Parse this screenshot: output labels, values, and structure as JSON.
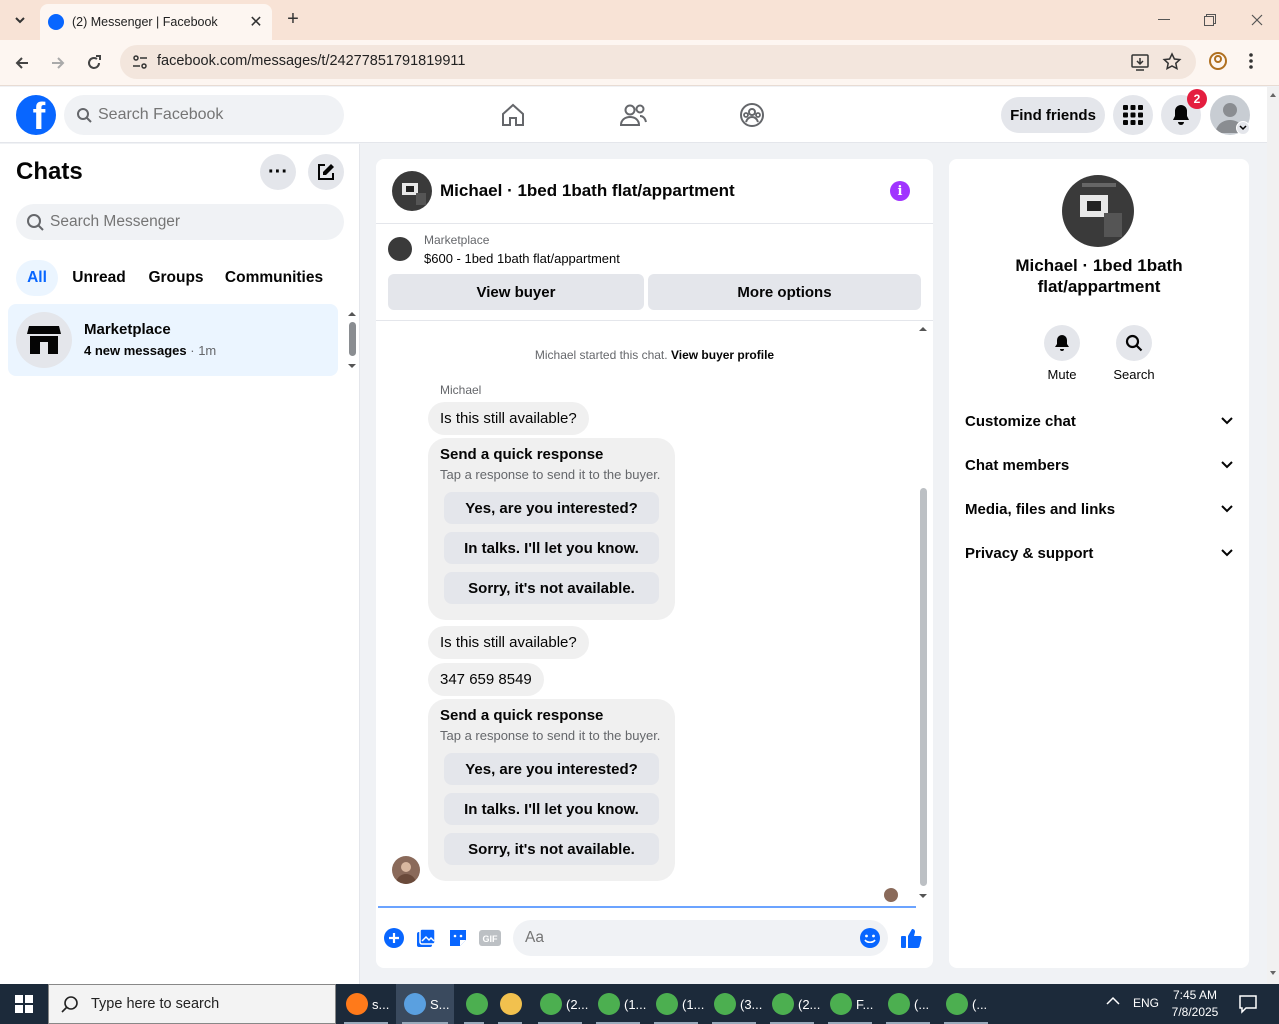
{
  "browser": {
    "tab_title": "(2) Messenger | Facebook",
    "url": "facebook.com/messages/t/24277851791819911"
  },
  "fb_header": {
    "search_placeholder": "Search Facebook",
    "find_friends": "Find friends",
    "notification_count": "2"
  },
  "chats_panel": {
    "title": "Chats",
    "search_placeholder": "Search Messenger",
    "filters": [
      "All",
      "Unread",
      "Groups",
      "Communities"
    ],
    "active_filter": "All",
    "conversations": [
      {
        "name": "Marketplace",
        "preview": "4 new messages",
        "time": "1m"
      }
    ]
  },
  "conversation": {
    "title": "Michael · 1bed 1bath flat/appartment",
    "marketplace_label": "Marketplace",
    "listing": "$600 - 1bed 1bath flat/appartment",
    "view_buyer": "View buyer",
    "more_options": "More options",
    "system_text": "Michael started this chat.",
    "system_link": "View buyer profile",
    "sender": "Michael",
    "messages": [
      {
        "type": "text",
        "text": "Is this still available?"
      },
      {
        "type": "quick",
        "heading": "Send a quick response",
        "sub": "Tap a response to send it to the buyer.",
        "options": [
          "Yes, are you interested?",
          "In talks. I'll let you know.",
          "Sorry, it's not available."
        ]
      },
      {
        "type": "text",
        "text": "Is this still available?"
      },
      {
        "type": "text",
        "text": "347 659 8549"
      },
      {
        "type": "quick",
        "heading": "Send a quick response",
        "sub": "Tap a response to send it to the buyer.",
        "options": [
          "Yes, are you interested?",
          "In talks. I'll let you know.",
          "Sorry, it's not available."
        ]
      }
    ],
    "composer_placeholder": "Aa"
  },
  "info_panel": {
    "name": "Michael · 1bed 1bath flat/appartment",
    "actions": [
      {
        "label": "Mute"
      },
      {
        "label": "Search"
      }
    ],
    "sections": [
      "Customize chat",
      "Chat members",
      "Media, files and links",
      "Privacy & support"
    ]
  },
  "taskbar": {
    "search_placeholder": "Type here to search",
    "apps": [
      {
        "label": "s...",
        "color": "#ff7a1a"
      },
      {
        "label": "S...",
        "color": "#5aa0e0"
      },
      {
        "label": "",
        "color": "#4caf50"
      },
      {
        "label": "",
        "color": "#f2c14e"
      },
      {
        "label": "(2...",
        "color": "#4caf50"
      },
      {
        "label": "(1...",
        "color": "#4caf50"
      },
      {
        "label": "(1...",
        "color": "#4caf50"
      },
      {
        "label": "(3...",
        "color": "#4caf50"
      },
      {
        "label": "(2...",
        "color": "#4caf50"
      },
      {
        "label": "F...",
        "color": "#4caf50"
      },
      {
        "label": "(...",
        "color": "#4caf50"
      },
      {
        "label": "(...",
        "color": "#4caf50"
      }
    ],
    "lang": "ENG",
    "time": "7:45 AM",
    "date": "7/8/2025"
  },
  "colors": {
    "accent": "#0866ff",
    "badge": "#e41e3f",
    "info": "#a033ff"
  }
}
